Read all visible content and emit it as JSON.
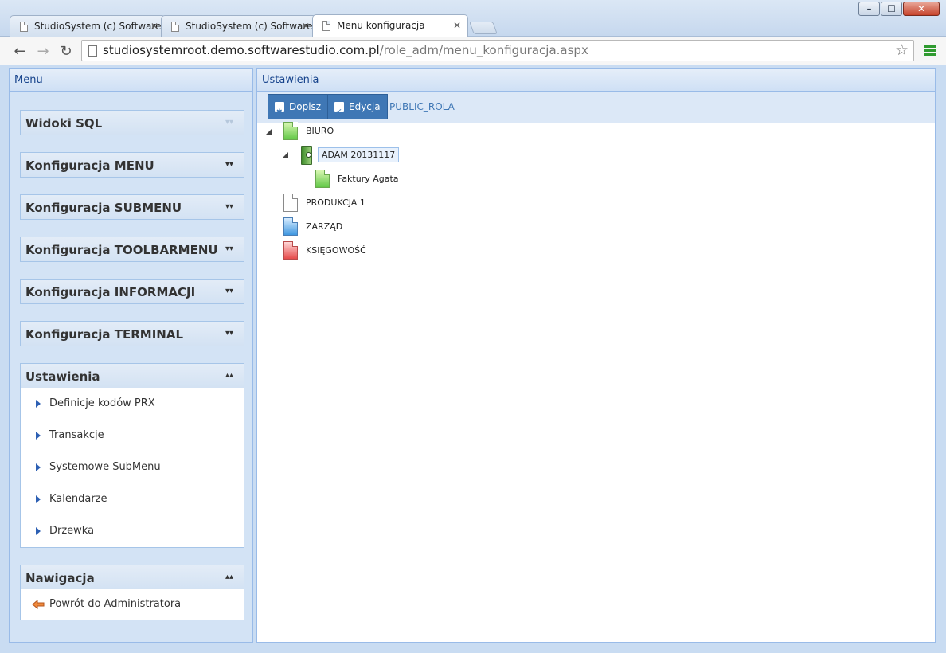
{
  "browser": {
    "tabs": [
      {
        "label": "StudioSystem (c) Software",
        "active": false
      },
      {
        "label": "StudioSystem (c) Software",
        "active": false
      },
      {
        "label": "Menu konfiguracja",
        "active": true
      }
    ],
    "url_host": "studiosystemroot.demo.softwarestudio.com.pl",
    "url_path": "/role_adm/menu_konfiguracja.aspx",
    "icons": {
      "back": "back-arrow-icon",
      "forward": "forward-arrow-icon",
      "reload": "reload-icon",
      "bookmark": "star-icon",
      "menu": "hamburger-menu-icon"
    }
  },
  "menu_panel": {
    "title": "Menu",
    "sections": [
      {
        "label": "Widoki SQL",
        "expanded": false
      },
      {
        "label": "Konfiguracja MENU",
        "expanded": false
      },
      {
        "label": "Konfiguracja SUBMENU",
        "expanded": false
      },
      {
        "label": "Konfiguracja TOOLBARMENU",
        "expanded": false
      },
      {
        "label": "Konfiguracja INFORMACJI",
        "expanded": false
      },
      {
        "label": "Konfiguracja TERMINAL",
        "expanded": false
      }
    ],
    "settings": {
      "label": "Ustawienia",
      "items": [
        "Definicje kodów PRX",
        "Transakcje",
        "Systemowe SubMenu",
        "Kalendarze",
        "Drzewka"
      ]
    },
    "navigation": {
      "label": "Nawigacja",
      "items": [
        "Powrót do Administratora"
      ]
    }
  },
  "settings_panel": {
    "title": "Ustawienia",
    "toolbar": {
      "add_label": "Dopisz",
      "edit_label": "Edycja",
      "role_name": "PUBLIC_ROLA"
    },
    "tree": [
      {
        "label": "BIURO",
        "icon": "green-document-icon",
        "expanded": true
      },
      {
        "label": "ADAM 20131117",
        "icon": "green-binder-icon",
        "expanded": true,
        "selected": true
      },
      {
        "label": "Faktury Agata",
        "icon": "green-document-icon",
        "expanded": false
      },
      {
        "label": "PRODUKCJA 1",
        "icon": "white-document-icon",
        "expanded": false
      },
      {
        "label": "ZARZĄD",
        "icon": "blue-document-icon",
        "expanded": false
      },
      {
        "label": "KSIĘGOWOŚĆ",
        "icon": "red-document-icon",
        "expanded": false
      }
    ]
  },
  "colors": {
    "accent": "#3f77b5",
    "header_text": "#15428b",
    "panel_bg": "#d3e3f5"
  }
}
